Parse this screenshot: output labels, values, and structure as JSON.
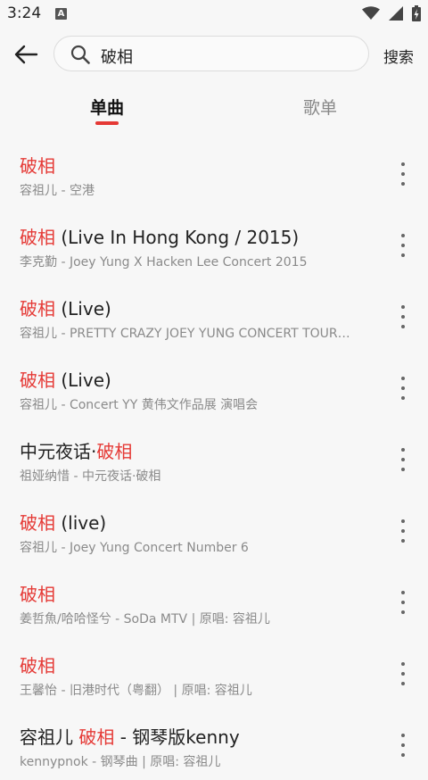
{
  "status_bar": {
    "time": "3:24",
    "notification_icon": "A"
  },
  "search": {
    "query": "破相",
    "submit_label": "搜索"
  },
  "tabs": [
    {
      "label": "单曲",
      "active": true
    },
    {
      "label": "歌单",
      "active": false
    }
  ],
  "colors": {
    "accent": "#e53935",
    "subtext": "#8a8a8a",
    "background": "#f7f7f7"
  },
  "results": [
    {
      "title_pre": "",
      "title_hl": "破相",
      "title_post": "",
      "subtitle": "容祖儿 - 空港"
    },
    {
      "title_pre": "",
      "title_hl": "破相",
      "title_post": " (Live In Hong Kong / 2015)",
      "subtitle": "李克勤 - Joey Yung X Hacken Lee Concert 2015"
    },
    {
      "title_pre": "",
      "title_hl": "破相",
      "title_post": " (Live)",
      "subtitle": "容祖儿 - PRETTY CRAZY JOEY YUNG CONCERT TOUR…"
    },
    {
      "title_pre": "",
      "title_hl": "破相",
      "title_post": " (Live)",
      "subtitle": "容祖儿 - Concert YY 黄伟文作品展 演唱会"
    },
    {
      "title_pre": "中元夜话·",
      "title_hl": "破相",
      "title_post": "",
      "subtitle": "祖娅纳惜 - 中元夜话·破相"
    },
    {
      "title_pre": "",
      "title_hl": "破相",
      "title_post": " (live)",
      "subtitle": "容祖儿 - Joey Yung Concert Number 6"
    },
    {
      "title_pre": "",
      "title_hl": "破相",
      "title_post": "",
      "subtitle": "姜哲魚/哈哈怪兮 - SoDa MTV | 原唱: 容祖儿"
    },
    {
      "title_pre": "",
      "title_hl": "破相",
      "title_post": "",
      "subtitle": "王馨怡 - 旧港时代（粤翻） | 原唱: 容祖儿"
    },
    {
      "title_pre": "容祖儿 ",
      "title_hl": "破相",
      "title_post": " - 钢琴版kenny",
      "subtitle": "kennypnok - 钢琴曲 | 原唱: 容祖儿"
    }
  ]
}
